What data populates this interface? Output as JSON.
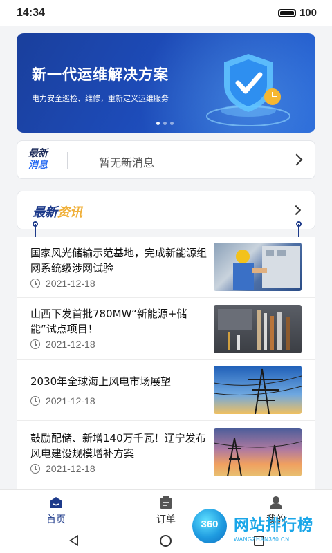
{
  "status_bar": {
    "time": "14:34",
    "battery": "100"
  },
  "banner": {
    "title": "新一代运维解决方案",
    "subtitle": "电力安全巡检、维修，重新定义运维服务",
    "icon": "shield-check-icon",
    "slide_count": 3,
    "active_slide": 0
  },
  "messages": {
    "logo_line1": "最新",
    "logo_line2": "消息",
    "text": "暂无新消息"
  },
  "news": {
    "header_a": "最新",
    "header_b": "资讯",
    "items": [
      {
        "title": "国家风光储输示范基地，完成新能源组网系统级涉网试验",
        "date": "2021-12-18",
        "thumb": "worker-electrical-panel"
      },
      {
        "title": "山西下发首批780MW“新能源+储能”试点项目！",
        "date": "2021-12-18",
        "thumb": "tools-toolbox"
      },
      {
        "title": "2030年全球海上风电市场展望",
        "date": "2021-12-18",
        "thumb": "power-tower-sky"
      },
      {
        "title": "鼓励配储、新增140万千瓦！辽宁发布风电建设规模增补方案",
        "date": "2021-12-18",
        "thumb": "power-lines-sunset"
      }
    ]
  },
  "tabbar": {
    "home": "首页",
    "orders": "订单",
    "mine": "我的",
    "active_color": "#1d3a8a",
    "inactive_color": "#555555"
  },
  "watermark": {
    "badge": "360",
    "text": "网站排行榜",
    "url": "WANGZHAN360.CN"
  }
}
